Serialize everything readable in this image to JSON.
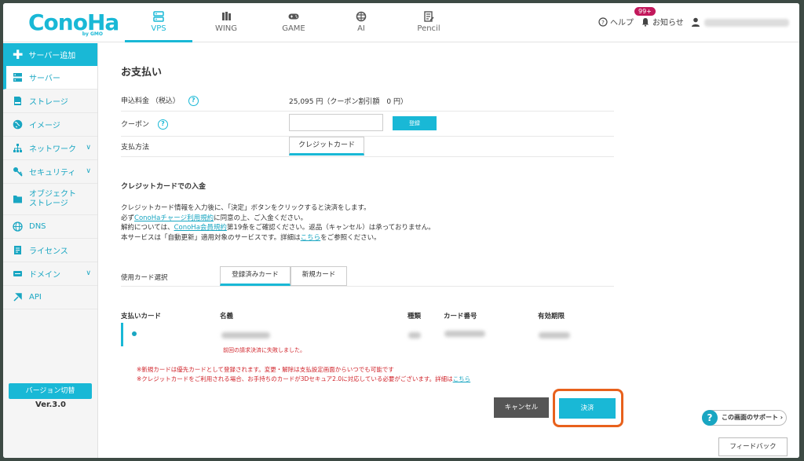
{
  "header": {
    "logo_text": "ConoHa",
    "logo_sub": "by GMO",
    "tabs": [
      {
        "label": "VPS",
        "icon": "server-icon"
      },
      {
        "label": "WING",
        "icon": "wing-icon"
      },
      {
        "label": "GAME",
        "icon": "gamepad-icon"
      },
      {
        "label": "AI",
        "icon": "ai-chip-icon"
      },
      {
        "label": "Pencil",
        "icon": "pencil-doc-icon"
      }
    ],
    "help_label": "ヘルプ",
    "notice_label": "お知らせ",
    "notice_badge": "99+"
  },
  "sidebar": {
    "add_label": "サーバー追加",
    "items": [
      {
        "label": "サーバー",
        "icon": "server-icon"
      },
      {
        "label": "ストレージ",
        "icon": "storage-icon"
      },
      {
        "label": "イメージ",
        "icon": "globe-image-icon"
      },
      {
        "label": "ネットワーク",
        "icon": "network-icon"
      },
      {
        "label": "セキュリティ",
        "icon": "key-icon"
      },
      {
        "label": "オブジェクト\nストレージ",
        "icon": "folder-icon"
      },
      {
        "label": "DNS",
        "icon": "dns-globe-icon"
      },
      {
        "label": "ライセンス",
        "icon": "license-icon"
      },
      {
        "label": "ドメイン",
        "icon": "domain-icon"
      },
      {
        "label": "API",
        "icon": "api-icon"
      }
    ],
    "version_button": "バージョン切替",
    "version_text": "Ver.3.0"
  },
  "main": {
    "title": "お支払い",
    "fee_label": "申込料金 （税込）",
    "fee_value": "25,095 円（クーポン割引額　0 円）",
    "coupon_label": "クーポン",
    "coupon_register": "登録",
    "method_label": "支払方法",
    "method_value": "クレジットカード",
    "section_title": "クレジットカードでの入金",
    "para1": "クレジットカード情報を入力後に、「決定」ボタンをクリックすると決済をします。",
    "para2_a": "必ず",
    "para2_link": "ConoHaチャージ利用規約",
    "para2_b": "に同意の上、ご入金ください。",
    "para3_a": "解約については、",
    "para3_link": "ConoHa会員規約",
    "para3_b": "第19条をご確認ください。返品（キャンセル）は承っておりません。",
    "para4_a": "本サービスは「自動更新」適用対象のサービスです。詳細は",
    "para4_link": "こちら",
    "para4_b": "をご参照ください。",
    "card_select_label": "使用カード選択",
    "card_tab_registered": "登録済みカード",
    "card_tab_new": "新規カード",
    "table_headers": [
      "支払いカード",
      "名義",
      "種類",
      "カード番号",
      "有効期限"
    ],
    "error_text": "前回の請求決済に失敗しました。",
    "notice1": "※新規カードは優先カードとして登録されます。変更・解除は支払設定画面からいつでも可能です",
    "notice2_a": "※クレジットカードをご利用される場合、お手持ちのカードが3Dセキュア2.0に対応している必要がございます。詳細は",
    "notice2_link": "こちら",
    "cancel_label": "キャンセル",
    "submit_label": "決済",
    "support_label": "この画面のサポート",
    "feedback_label": "フィードバック"
  },
  "colors": {
    "accent": "#19b8d6",
    "error": "#d0242b",
    "highlight": "#e8611c"
  }
}
